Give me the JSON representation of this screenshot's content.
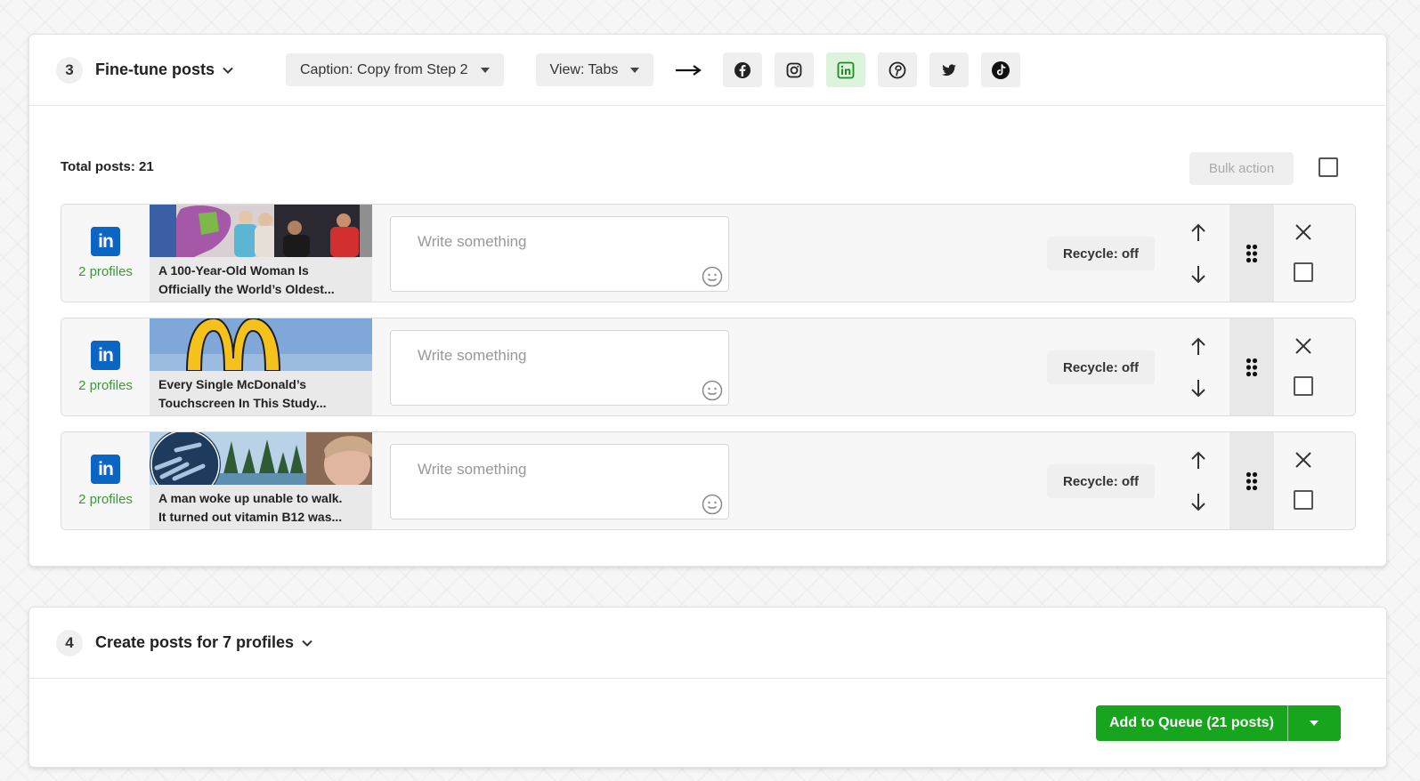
{
  "step3": {
    "number": "3",
    "title": "Fine-tune posts",
    "caption_dropdown": "Caption: Copy from Step 2",
    "view_dropdown": "View: Tabs",
    "networks": [
      "facebook-icon",
      "instagram-icon",
      "linkedin-icon",
      "pinterest-icon",
      "twitter-icon",
      "tiktok-icon"
    ],
    "active_network": "linkedin-icon",
    "total_posts": "Total posts: 21",
    "bulk_action": "Bulk action"
  },
  "posts": [
    {
      "network_icon": "linkedin-icon",
      "profiles": "2 profiles",
      "title_line1": "A 100-Year-Old Woman Is",
      "title_line2": "Officially the World’s Oldest...",
      "placeholder": "Write something",
      "recycle": "Recycle: off"
    },
    {
      "network_icon": "linkedin-icon",
      "profiles": "2 profiles",
      "title_line1": "Every Single McDonald’s",
      "title_line2": "Touchscreen In This Study...",
      "placeholder": "Write something",
      "recycle": "Recycle: off"
    },
    {
      "network_icon": "linkedin-icon",
      "profiles": "2 profiles",
      "title_line1": "A man woke up unable to walk.",
      "title_line2": "It turned out vitamin B12 was...",
      "placeholder": "Write something",
      "recycle": "Recycle: off"
    }
  ],
  "step4": {
    "number": "4",
    "title": "Create posts for 7 profiles",
    "queue_button": "Add to Queue (21 posts)"
  },
  "colors": {
    "accent_green": "#16a51c",
    "linkedin_blue": "#0a66c2",
    "profiles_green": "#3a9a3a"
  }
}
